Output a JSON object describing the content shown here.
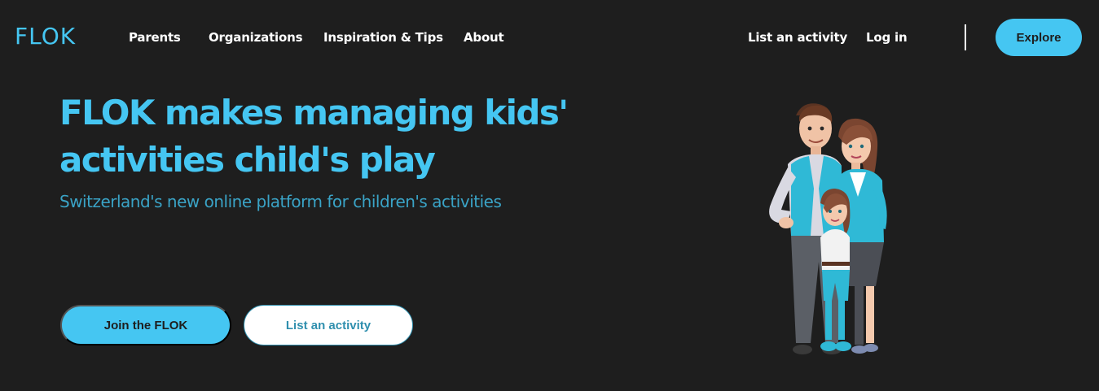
{
  "brand": {
    "logo_text": "FLOK",
    "accent_color": "#45c6f2",
    "background_color": "#1e1e1e"
  },
  "nav": {
    "links": [
      {
        "label": "Parents"
      },
      {
        "label": "Organizations"
      },
      {
        "label": "Inspiration & Tips"
      },
      {
        "label": "About"
      }
    ],
    "right_links": [
      {
        "label": "List an activity"
      },
      {
        "label": "Log in"
      }
    ],
    "cta_label": "Explore"
  },
  "hero": {
    "title": "FLOK makes managing kids' activities child's play",
    "subtitle": "Switzerland's new online platform for children's activities",
    "primary_button": "Join the FLOK",
    "secondary_button": "List an activity",
    "illustration": "family-illustration"
  }
}
